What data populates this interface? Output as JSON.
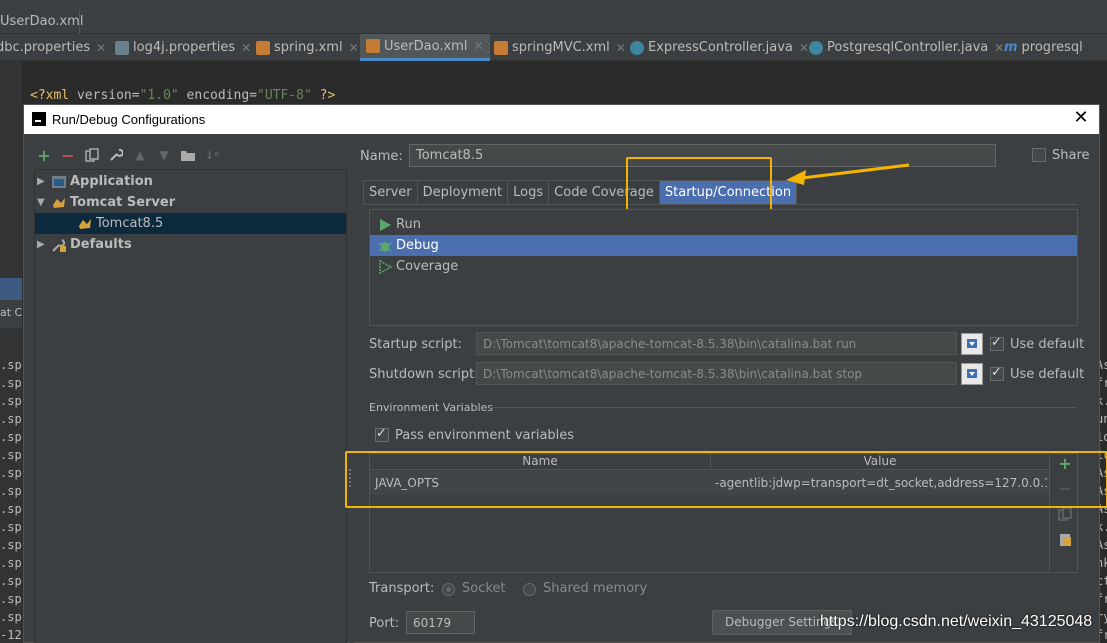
{
  "breadcrumb": {
    "file": "UserDao.xml"
  },
  "editor_tabs": [
    {
      "label": "dbc.properties",
      "icon": "properties-file-icon",
      "active": false
    },
    {
      "label": "log4j.properties",
      "icon": "properties-file-icon",
      "active": false
    },
    {
      "label": "spring.xml",
      "icon": "xml-file-icon",
      "active": false
    },
    {
      "label": "UserDao.xml",
      "icon": "xml-file-icon",
      "active": true
    },
    {
      "label": "springMVC.xml",
      "icon": "xml-file-icon",
      "active": false
    },
    {
      "label": "ExpressController.java",
      "icon": "java-class-icon",
      "active": false
    },
    {
      "label": "PostgresqlController.java",
      "icon": "java-class-icon",
      "active": false
    },
    {
      "label": "progresql",
      "icon": "method-icon",
      "active": false
    }
  ],
  "editor": {
    "line_tag_open": "<?xml",
    "attr1_name": " version=",
    "attr1_value": "\"1.0\"",
    "attr2_name": " encoding=",
    "attr2_value": "\"UTF-8\"",
    "line_tag_close": " ?>"
  },
  "bottom_panel": {
    "tab_fragment": "at Ca",
    "console_lines": [
      ".sp",
      ".sp",
      ".sp",
      ".sp",
      ".sp",
      ".sp",
      ".sp",
      ".sp",
      ".sp",
      ".sp",
      ".sp",
      ".sp",
      ".sp",
      ".sp",
      ".sp",
      "-12"
    ],
    "right_lines": [
      "As",
      "fr",
      "k.",
      "un",
      "io",
      "ic",
      "As",
      "As",
      "As",
      "k.",
      "As",
      "nk",
      "ct",
      "fr",
      "ry",
      "fr"
    ]
  },
  "dialog": {
    "title": "Run/Debug Configurations",
    "close": "✕",
    "tree": [
      {
        "label": "Application",
        "expanded": false,
        "bold": true,
        "level": 0,
        "icon": "application-icon"
      },
      {
        "label": "Tomcat Server",
        "expanded": true,
        "bold": true,
        "level": 0,
        "icon": "tomcat-icon"
      },
      {
        "label": "Tomcat8.5",
        "bold": false,
        "level": 1,
        "selected": true,
        "icon": "tomcat-icon"
      },
      {
        "label": "Defaults",
        "expanded": false,
        "bold": true,
        "level": 0,
        "icon": "defaults-icon"
      }
    ],
    "name_label": "Name:",
    "name_value": "Tomcat8.5",
    "share_label": "Share",
    "share_checked": false,
    "tabs": [
      "Server",
      "Deployment",
      "Logs",
      "Code Coverage",
      "Startup/Connection"
    ],
    "active_tab": "Startup/Connection",
    "executors": [
      {
        "label": "Run",
        "icon": "run-icon",
        "selected": false
      },
      {
        "label": "Debug",
        "icon": "debug-icon",
        "selected": true
      },
      {
        "label": "Coverage",
        "icon": "coverage-icon",
        "selected": false
      }
    ],
    "startup_label": "Startup script:",
    "startup_value": "D:\\Tomcat\\tomcat8\\apache-tomcat-8.5.38\\bin\\catalina.bat run",
    "startup_use_default": "Use default",
    "shutdown_label": "Shutdown script:",
    "shutdown_value": "D:\\Tomcat\\tomcat8\\apache-tomcat-8.5.38\\bin\\catalina.bat stop",
    "shutdown_use_default": "Use default",
    "env_section": "Environment Variables",
    "pass_env_label": "Pass environment variables",
    "env_headers": {
      "name": "Name",
      "value": "Value"
    },
    "env_rows": [
      {
        "name": "JAVA_OPTS",
        "value": "-agentlib:jdwp=transport=dt_socket,address=127.0.0.1:..."
      }
    ],
    "transport_label": "Transport:",
    "transport_socket": "Socket",
    "transport_shared": "Shared memory",
    "port_label": "Port:",
    "port_value": "60179",
    "debugger_button": "Debugger Settings"
  },
  "annotations": {
    "highlight_color": "#f5b400"
  },
  "watermark": "https://blog.csdn.net/weixin_43125048"
}
